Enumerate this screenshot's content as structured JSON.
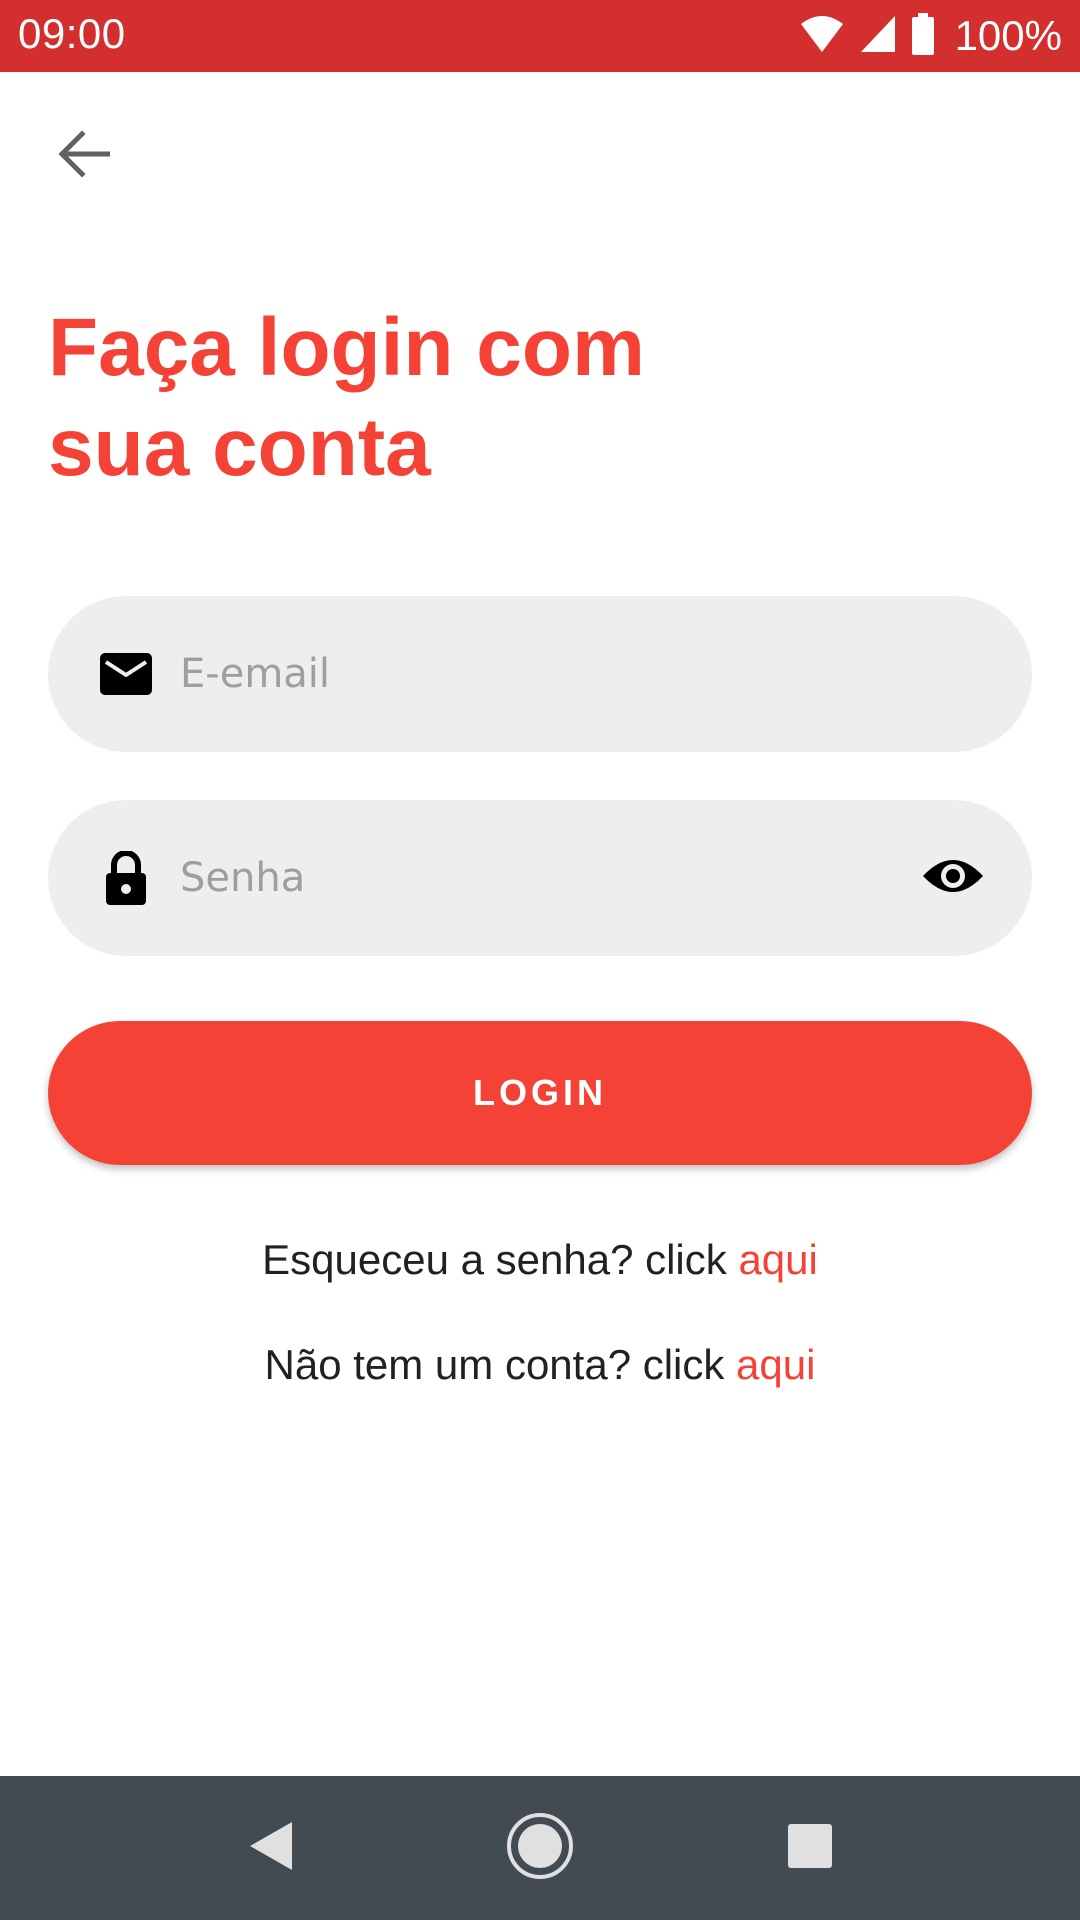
{
  "status_bar": {
    "time": "09:00",
    "battery": "100%",
    "icons": [
      "wifi-icon",
      "signal-icon",
      "battery-icon"
    ],
    "background": "#d32f2f"
  },
  "header": {
    "back_icon": "arrow-back-icon"
  },
  "title": {
    "line1": "Faça login com",
    "line2": "sua conta",
    "color": "#f44336"
  },
  "form": {
    "email": {
      "placeholder": "E-email",
      "value": "",
      "icon": "email-icon"
    },
    "password": {
      "placeholder": "Senha",
      "value": "",
      "icon": "lock-icon",
      "toggle_icon": "eye-icon"
    },
    "login_label": "LOGIN"
  },
  "links": {
    "forgot_text": "Esqueceu a senha? click ",
    "forgot_link": "aqui",
    "signup_text": "Não tem um conta? click ",
    "signup_link": "aqui"
  },
  "nav_bar": {
    "buttons": [
      "back-triangle-icon",
      "home-circle-icon",
      "recents-square-icon"
    ],
    "background": "#434b52"
  }
}
